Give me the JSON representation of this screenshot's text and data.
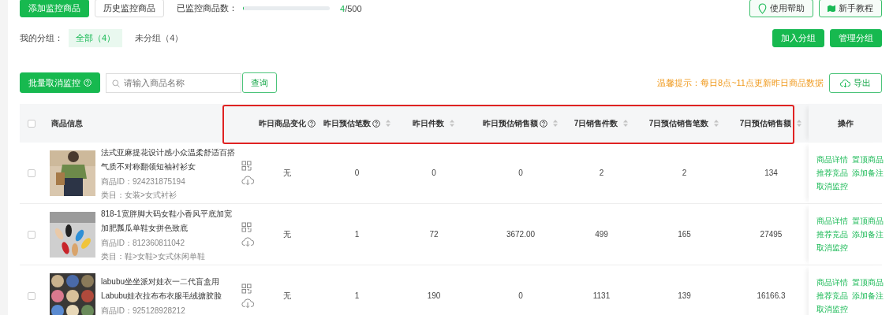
{
  "toolbar": {
    "add_button": "添加监控商品",
    "history_button": "历史监控商品",
    "monitor_count": {
      "label": "已监控商品数：",
      "level": 0.008,
      "count": "4",
      "total": "/500"
    },
    "help_button": "使用帮助",
    "tutorial_button": "新手教程"
  },
  "groups": {
    "label": "我的分组：",
    "tabs": [
      {
        "label": "全部（4）",
        "selected": true
      },
      {
        "label": "未分组（4）",
        "selected": false
      }
    ],
    "buttons": [
      "加入分组",
      "管理分组"
    ]
  },
  "actions": {
    "batch_button": "批量取消监控",
    "search": {
      "placeholder": "请输入商品名称"
    },
    "query_button": "查询",
    "tip": "温馨提示：每日8点~11点更新昨日商品数据",
    "export_button": "导出"
  },
  "table": {
    "select_all": {
      "checked": false
    },
    "columns": [
      {
        "label": "商品信息",
        "help": false,
        "sortable": false
      },
      {
        "label": "昨日商品变化",
        "help": true,
        "sortable": false
      },
      {
        "label": "昨日预估笔数",
        "help": true,
        "sortable": true
      },
      {
        "label": "昨日件数",
        "help": false,
        "sortable": true
      },
      {
        "label": "昨日预估销售额",
        "help": true,
        "sortable": true
      },
      {
        "label": "7日销售件数",
        "help": false,
        "sortable": true
      },
      {
        "label": "7日预估销售笔数",
        "help": false,
        "sortable": true
      },
      {
        "label": "7日预估销售额",
        "help": false,
        "sortable": true
      },
      {
        "label": "操作",
        "help": false,
        "sortable": false
      }
    ],
    "rows": [
      {
        "checked": false,
        "title": "法式亚麻提花设计感小众温柔舒适百搭气质不对称翻领短袖衬衫女",
        "product_id": "商品ID：924231875194",
        "category": "类目：女装>女式衬衫",
        "values": [
          "无",
          "0",
          "0",
          "0",
          "2",
          "2",
          "134"
        ],
        "actions": [
          "商品详情",
          "置顶商品",
          "推荐竞品",
          "添加备注",
          "取消监控"
        ]
      },
      {
        "checked": false,
        "title": "818-1宽胖脚大码女鞋小香风平底加宽加肥瓢瓜单鞋女拼色致底",
        "product_id": "商品ID：812360811042",
        "category": "类目：鞋>女鞋>女式休闲单鞋",
        "values": [
          "无",
          "1",
          "72",
          "3672.00",
          "499",
          "165",
          "27495"
        ],
        "actions": [
          "商品详情",
          "置顶商品",
          "推荐竞品",
          "添加备注",
          "取消监控"
        ]
      },
      {
        "checked": false,
        "title": "labubu坐坐派对娃衣一二代盲盒用Labubu娃衣拉布布衣服毛绒搪胶脸",
        "product_id": "商品ID：925128928212",
        "values": [
          "无",
          "1",
          "190",
          "0",
          "1131",
          "139",
          "16166.3"
        ],
        "actions": [
          "商品详情",
          "置顶商品",
          "推荐竞品",
          "添加备注",
          "取消监控"
        ]
      }
    ]
  },
  "highlight": {
    "shown": true
  }
}
